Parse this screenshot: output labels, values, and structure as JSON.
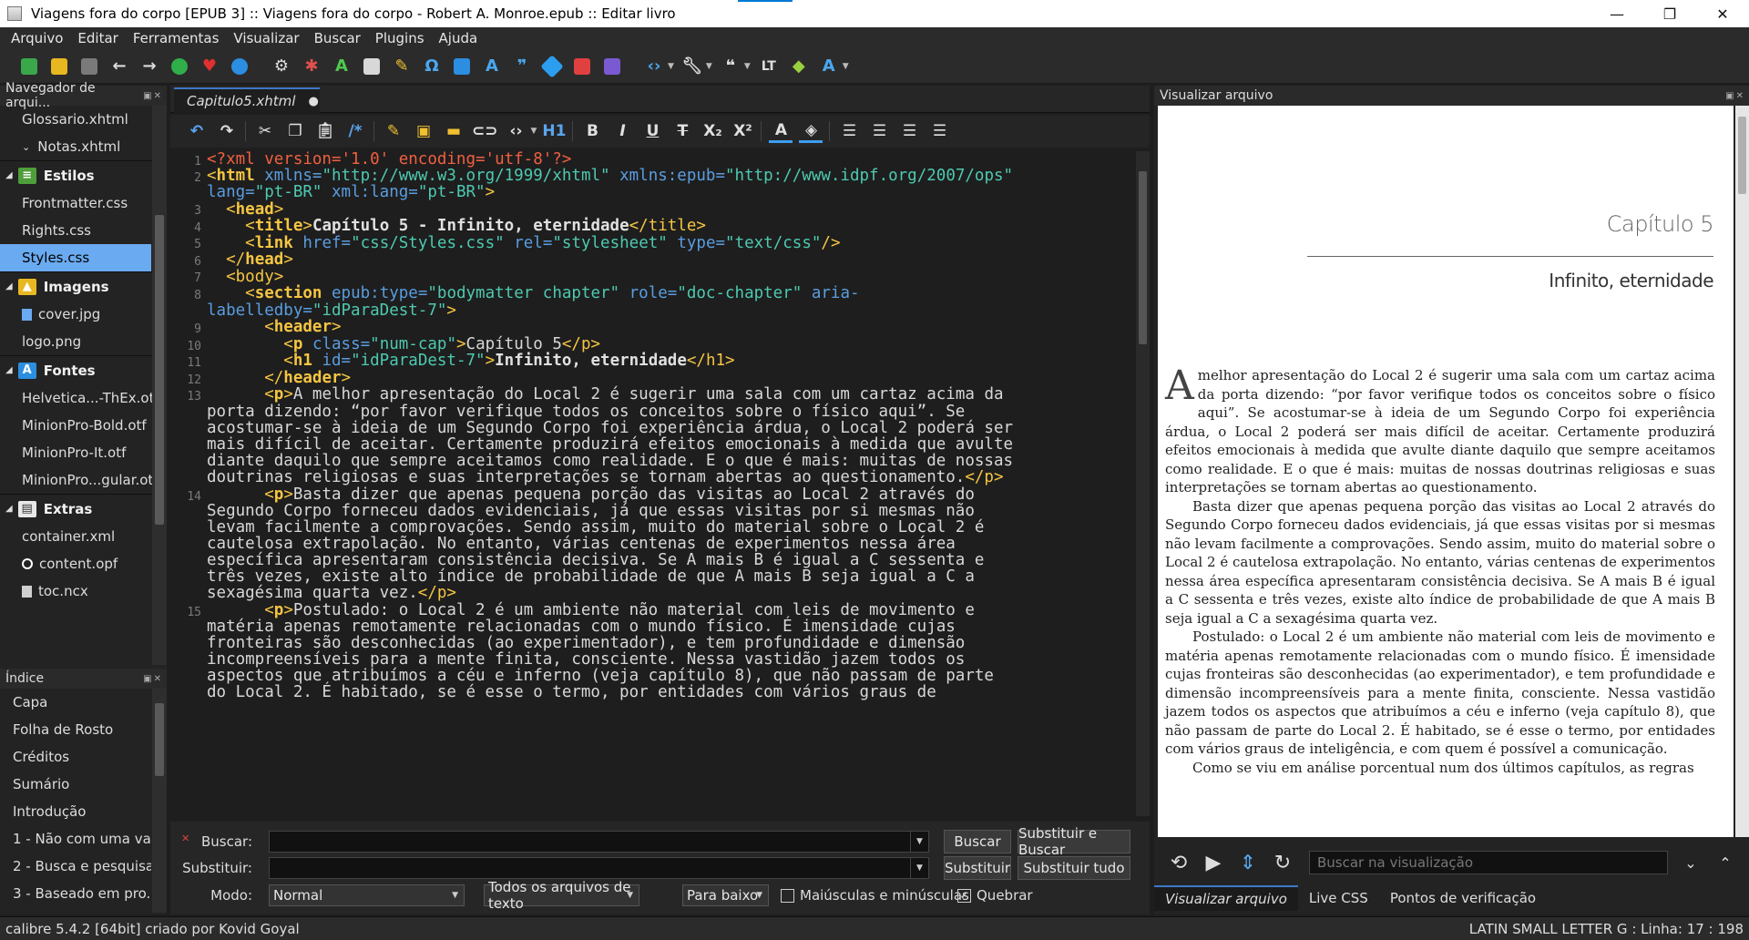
{
  "window": {
    "title": "Viagens fora do corpo [EPUB 3] :: Viagens fora do corpo - Robert A. Monroe.epub :: Editar livro",
    "minimize": "—",
    "maximize": "❐",
    "close": "✕"
  },
  "menu": [
    "Arquivo",
    "Editar",
    "Ferramentas",
    "Visualizar",
    "Buscar",
    "Plugins",
    "Ajuda"
  ],
  "file_browser": {
    "title": "Navegador de arqui...",
    "items_top": [
      "Glossario.xhtml",
      "Notas.xhtml"
    ],
    "categories": {
      "styles": {
        "label": "Estilos",
        "items": [
          "Frontmatter.css",
          "Rights.css",
          "Styles.css"
        ]
      },
      "images": {
        "label": "Imagens",
        "items": [
          "cover.jpg",
          "logo.png"
        ]
      },
      "fonts": {
        "label": "Fontes",
        "items": [
          "Helvetica...-ThEx.otf",
          "MinionPro-Bold.otf",
          "MinionPro-It.otf",
          "MinionPro...gular.otf"
        ]
      },
      "extras": {
        "label": "Extras",
        "items": [
          "container.xml",
          "content.opf",
          "toc.ncx"
        ]
      }
    }
  },
  "index": {
    "title": "Índice",
    "items": [
      "Capa",
      "Folha de Rosto",
      "Créditos",
      "Sumário",
      "Introdução",
      "1 - Não com uma va...",
      "2 - Busca e pesquisa",
      "3 - Baseado em pro..."
    ]
  },
  "editor": {
    "tab_label": "Capitulo5.xhtml",
    "heading_button": "H1",
    "line_numbers": [
      "1",
      "2",
      "3",
      "4",
      "5",
      "6",
      "7",
      "8",
      "9",
      "10",
      "11",
      "12",
      "13",
      "14",
      "15"
    ]
  },
  "code": {
    "l1": "<?xml version='1.0' encoding='utf-8'?>",
    "l2_tag": "html",
    "l2_a1": "xmlns=",
    "l2_v1": "\"http://www.w3.org/1999/xhtml\"",
    "l2_a2": "xmlns:epub=",
    "l2_v2": "\"http://www.idpf.org/2007/ops\"",
    "l2_a3": "lang=",
    "l2_v3": "\"pt-BR\"",
    "l2_a4": "xml:lang=",
    "l2_v4": "\"pt-BR\"",
    "l3_tag": "head",
    "l4_tag": "title",
    "l4_text": "Capítulo 5 - Infinito, eternidade",
    "l5_tag": "link",
    "l5_a1": "href=",
    "l5_v1": "\"css/Styles.css\"",
    "l5_a2": "rel=",
    "l5_v2": "\"stylesheet\"",
    "l5_a3": "type=",
    "l5_v3": "\"text/css\"",
    "l6_tag": "head",
    "l7_tag": "body",
    "l8_tag": "section",
    "l8_a1": "epub:type=",
    "l8_v1": "\"bodymatter chapter\"",
    "l8_a2": "role=",
    "l8_v2": "\"doc-chapter\"",
    "l8_a3a": "aria-",
    "l8_a3b": "labelledby=",
    "l8_v3": "\"idParaDest-7\"",
    "l9_tag": "header",
    "l10_tag": "p",
    "l10_a1": "class=",
    "l10_v1": "\"num-cap\"",
    "l10_text": "Capítulo 5",
    "l11_tag": "h1",
    "l11_a1": "id=",
    "l11_v1": "\"idParaDest-7\"",
    "l11_text": "Infinito, eternidade",
    "l12_tag": "header",
    "p13": [
      "A melhor apresentação do Local 2 é sugerir uma sala com um cartaz acima da",
      "porta dizendo: “por favor verifique todos os conceitos sobre o físico aqui”. Se",
      "acostumar-se à ideia de um Segundo Corpo foi experiência árdua, o Local 2 poderá ser",
      "mais difícil de aceitar. Certamente produzirá efeitos emocionais à medida que avulte",
      "diante daquilo que sempre aceitamos como realidade. E o que é mais: muitas de nossas",
      "doutrinas religiosas e suas interpretações se tornam abertas ao questionamento."
    ],
    "p14": [
      "Basta dizer que apenas pequena porção das visitas ao Local 2 através do",
      "Segundo Corpo forneceu dados evidenciais, já que essas visitas por si mesmas não",
      "levam facilmente a comprovações. Sendo assim, muito do material sobre o Local 2 é",
      "cautelosa extrapolação. No entanto, várias centenas de experimentos nessa área",
      "específica apresentaram consistência decisiva. Se A mais B é igual a C sessenta e",
      "três vezes, existe alto índice de probabilidade de que A mais B seja igual a C a",
      "sexagésima quarta vez."
    ],
    "p15": [
      "Postulado: o Local 2 é um ambiente não material com leis de movimento e",
      "matéria apenas remotamente relacionadas com o mundo físico. É imensidade cujas",
      "fronteiras são desconhecidas (ao experimentador), e tem profundidade e dimensão",
      "incompreensíveis para a mente finita, consciente. Nessa vastidão jazem todos os",
      "aspectos que atribuímos a céu e inferno (veja capítulo 8), que não passam de parte",
      "do Local 2. É habitado, se é esse o termo, por entidades com vários graus de"
    ]
  },
  "search": {
    "find_label": "Buscar:",
    "replace_label": "Substituir:",
    "mode_label": "Modo:",
    "find_button": "Buscar",
    "replace_find_button": "Substituir e Buscar",
    "replace_button": "Substituir",
    "replace_all_button": "Substituir tudo",
    "mode_value": "Normal",
    "scope_value": "Todos os arquivos de texto",
    "direction_value": "Para baixo",
    "case_label": "Maiúsculas e minúsculas",
    "case_checked": false,
    "wrap_label": "Quebrar",
    "wrap_checked": true,
    "find_value": "",
    "replace_value": ""
  },
  "preview": {
    "title": "Visualizar arquivo",
    "chapter_number": "Capítulo 5",
    "chapter_title": "Infinito, eternidade",
    "drop_cap": "A",
    "p1": "melhor apresentação do Local 2 é sugerir uma sala com um cartaz acima da porta dizendo: “por favor verifique todos os conceitos sobre o físico aqui”. Se acostumar-se à ideia de um Segundo Corpo foi experiência árdua, o Local 2 poderá ser mais difícil de aceitar. Certamente produzirá efeitos emocionais à medida que avulte diante daquilo que sempre aceitamos como realidade. E o que é mais: muitas de nossas doutrinas religiosas e suas interpretações se tornam abertas ao questionamento.",
    "p2": "Basta dizer que apenas pequena porção das visitas ao Local 2 através do Segundo Corpo forneceu dados evidenciais, já que essas visitas por si mesmas não levam facilmente a comprovações. Sendo assim, muito do material sobre o Local 2 é cautelosa extrapolação. No entanto, várias centenas de experimentos nessa área específica apresentaram consistência decisiva. Se A mais B é igual a C sessenta e três vezes, existe alto índice de probabilidade de que A mais B seja igual a C a sexagésima quarta vez.",
    "p3": "Postulado: o Local 2 é um ambiente não material com leis de movimento e matéria apenas remotamente relacionadas com o mundo físico. É imensidade cujas fronteiras são desconhecidas (ao experimentador), e tem profundidade e dimensão incompreensíveis para a mente finita, consciente. Nessa vastidão jazem todos os aspectos que atribuímos a céu e inferno (veja capítulo 8), que não passam de parte do Local 2. É habitado, se é esse o termo, por entidades com vários graus de inteligência, e com quem é possível a comunicação.",
    "p4": "Como se viu em análise porcentual num dos últimos capítulos, as regras",
    "search_placeholder": "Buscar na visualização",
    "tabs": [
      "Visualizar arquivo",
      "Live CSS",
      "Pontos de verificação"
    ]
  },
  "status": {
    "left": "calibre 5.4.2 [64bit] criado por Kovid Goyal",
    "right": "LATIN SMALL LETTER G : Linha: 17 : 198"
  },
  "colors": {
    "accent": "#3c78c8",
    "selection": "#6aaaf0",
    "tag": "#f5c542",
    "attribute": "#5a9de0",
    "string": "#4ec9b0"
  }
}
